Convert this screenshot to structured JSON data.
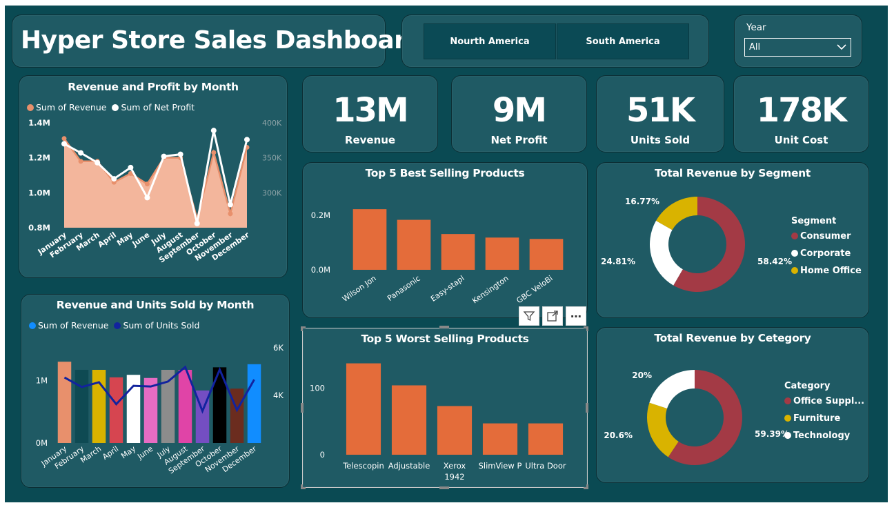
{
  "header": {
    "title": "Hyper Store Sales Dashboard",
    "regions": [
      "Nourth America",
      "South America"
    ],
    "year_label": "Year",
    "year_value": "All"
  },
  "kpis": [
    {
      "value": "13M",
      "label": "Revenue"
    },
    {
      "value": "9M",
      "label": "Net Profit"
    },
    {
      "value": "51K",
      "label": "Units Sold"
    },
    {
      "value": "178K",
      "label": "Unit Cost"
    }
  ],
  "colors": {
    "background": "#0a4a53",
    "card": "#1f5a64",
    "orange": "#e46c3a",
    "revenue_area": "#f3b69c",
    "consumer": "#a33a45",
    "corporate": "#ffffff",
    "home_office": "#d9b300"
  },
  "chart_data": [
    {
      "type": "area",
      "title": "Revenue and Profit by Month",
      "categories": [
        "January",
        "February",
        "March",
        "April",
        "May",
        "June",
        "July",
        "August",
        "September",
        "October",
        "November",
        "December"
      ],
      "series": [
        {
          "name": "Sum of Revenue",
          "axis": "left",
          "color": "#f3b69c",
          "values": [
            1310000,
            1180000,
            1180000,
            1060000,
            1110000,
            1050000,
            1200000,
            1200000,
            850000,
            1230000,
            880000,
            1260000
          ]
        },
        {
          "name": "Sum of Net Profit",
          "axis": "right",
          "color": "#ffffff",
          "values": [
            370000,
            357000,
            343000,
            320000,
            336000,
            293000,
            352000,
            355000,
            256000,
            389000,
            283000,
            376000
          ]
        }
      ],
      "y_ticks": [
        "0.8M",
        "1.0M",
        "1.2M",
        "1.4M"
      ],
      "y2_ticks": [
        "300K",
        "350K",
        "400K"
      ],
      "ylim": [
        800000,
        1400000
      ],
      "y2lim": [
        250000,
        400000
      ]
    },
    {
      "type": "bar",
      "title": "Revenue and Units Sold by Month",
      "categories": [
        "January",
        "February",
        "March",
        "April",
        "May",
        "June",
        "July",
        "August",
        "September",
        "October",
        "November",
        "December"
      ],
      "series": [
        {
          "name": "Sum of Revenue",
          "axis": "left",
          "color": "#118dff",
          "values": [
            1300000,
            1170000,
            1170000,
            1050000,
            1090000,
            1040000,
            1170000,
            1170000,
            840000,
            1210000,
            870000,
            1260000
          ]
        },
        {
          "name": "Sum of Units Sold",
          "axis": "right",
          "color": "#12239e",
          "values": [
            4750,
            4350,
            4550,
            3630,
            4400,
            4370,
            4580,
            5190,
            3340,
            5080,
            3380,
            4660
          ]
        }
      ],
      "bar_colors": [
        "#e8906c",
        "#0e4a53",
        "#d9b300",
        "#d64550",
        "#ffffff",
        "#e66cc3",
        "#e8aad0",
        "#8c8c8c",
        "#e044a7",
        "#744ec2",
        "#000000",
        "#6b2c1f",
        "#118dff"
      ],
      "y_ticks": [
        "0M",
        "1M"
      ],
      "y2_ticks": [
        "4K",
        "6K"
      ],
      "ylim": [
        0,
        1600000
      ],
      "y2lim": [
        2000,
        6200
      ]
    },
    {
      "type": "bar",
      "title": "Top 5 Best Selling Products",
      "categories": [
        "Wilson Jon",
        "Panasonic",
        "Easy-stapl",
        "Kensington",
        "GBC VeloBi"
      ],
      "values": [
        222000,
        183000,
        131000,
        118000,
        113000
      ],
      "y_ticks": [
        "0.0M",
        "0.2M"
      ],
      "ylim": [
        0,
        240000
      ]
    },
    {
      "type": "bar",
      "title": "Top 5 Worst Selling Products",
      "categories": [
        "Telescopin",
        "Adjustable",
        "Xerox 1942",
        "SlimView P",
        "Ultra Door"
      ],
      "values": [
        137,
        104,
        73,
        47,
        47
      ],
      "y_ticks": [
        "0",
        "100"
      ],
      "ylim": [
        0,
        150
      ]
    },
    {
      "type": "pie",
      "title": "Total Revenue by Segment",
      "legend_title": "Segment",
      "labels": [
        "Consumer",
        "Corporate",
        "Home Office"
      ],
      "values": [
        58.42,
        24.81,
        16.77
      ],
      "value_labels": [
        "58.42%",
        "24.81%",
        "16.77%"
      ],
      "colors": [
        "#a33a45",
        "#ffffff",
        "#d9b300"
      ]
    },
    {
      "type": "pie",
      "title": "Total Revenue by Cetegory",
      "legend_title": "Category",
      "labels": [
        "Office Suppl...",
        "Furniture",
        "Technology"
      ],
      "values": [
        59.39,
        20.6,
        20
      ],
      "value_labels": [
        "59.39%",
        "20.6%",
        "20%"
      ],
      "colors": [
        "#a33a45",
        "#d9b300",
        "#ffffff"
      ]
    }
  ]
}
